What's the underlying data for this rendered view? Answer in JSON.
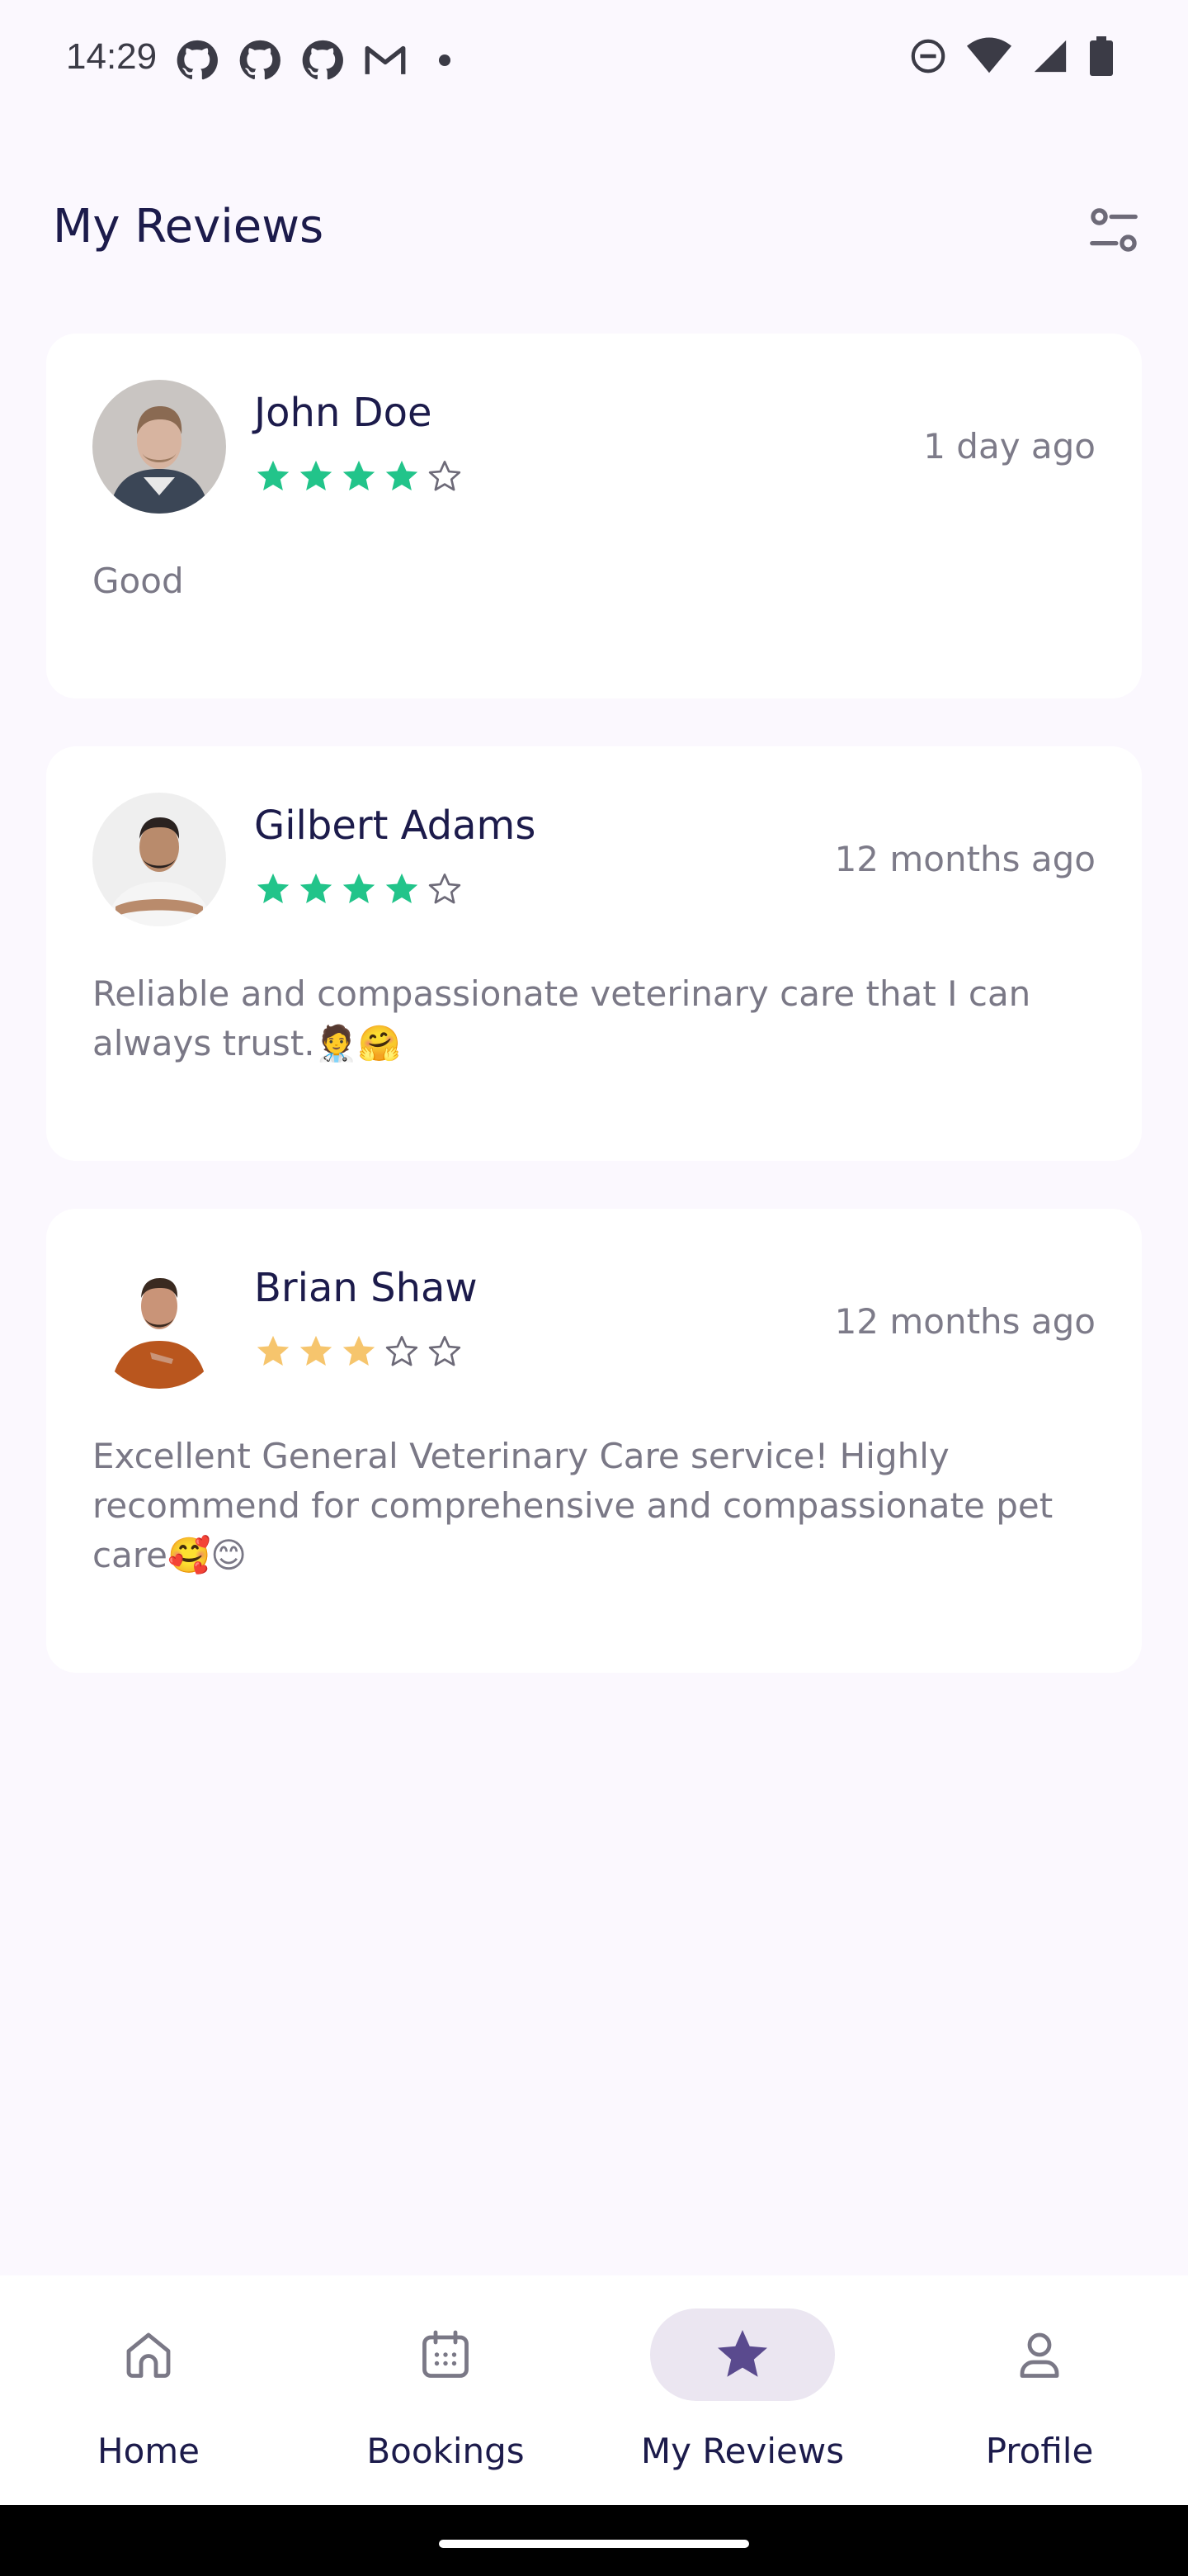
{
  "status_bar": {
    "time": "14:29",
    "left_icons": [
      "github-icon",
      "github-icon",
      "github-icon",
      "gmail-icon",
      "dot-icon"
    ],
    "right_icons": [
      "dnd-icon",
      "wifi-icon",
      "signal-icon",
      "battery-icon"
    ]
  },
  "header": {
    "title": "My Reviews",
    "filter_icon": "filter-icon"
  },
  "reviews": [
    {
      "name": "John Doe",
      "rating": 4,
      "max_rating": 5,
      "star_color": "#22c48a",
      "time_ago": "1 day ago",
      "text": "Good",
      "avatar_colors": {
        "bg": "#c9c5c2",
        "skin": "#d7b4a0",
        "hair": "#8a6a52",
        "shirt": "#3b4656"
      }
    },
    {
      "name": "Gilbert Adams",
      "rating": 4,
      "max_rating": 5,
      "star_color": "#22c48a",
      "time_ago": "12 months ago",
      "text": "Reliable and compassionate veterinary care that I can always trust.🧑‍⚕️🤗",
      "avatar_colors": {
        "bg": "#efefef",
        "skin": "#b98b6c",
        "hair": "#2a2220",
        "shirt": "#f5f5f5"
      }
    },
    {
      "name": "Brian Shaw",
      "rating": 3,
      "max_rating": 5,
      "star_color": "#f6c56d",
      "time_ago": "12 months ago",
      "text": "Excellent General Veterinary Care service! Highly recommend for comprehensive and compassionate pet care🥰😊",
      "avatar_colors": {
        "bg": "#ffffff",
        "skin": "#c99478",
        "hair": "#3a2a20",
        "shirt": "#b9561e"
      }
    }
  ],
  "bottom_nav": {
    "items": [
      {
        "label": "Home",
        "icon": "home-icon",
        "active": false
      },
      {
        "label": "Bookings",
        "icon": "calendar-icon",
        "active": false
      },
      {
        "label": "My Reviews",
        "icon": "star-icon",
        "active": true
      },
      {
        "label": "Profile",
        "icon": "person-icon",
        "active": false
      }
    ]
  },
  "colors": {
    "background": "#fbf8fe",
    "title": "#1c1b4b",
    "muted_text": "#7a7886",
    "active_accent": "#5a4a8e",
    "active_pill": "#ebe6f1"
  }
}
